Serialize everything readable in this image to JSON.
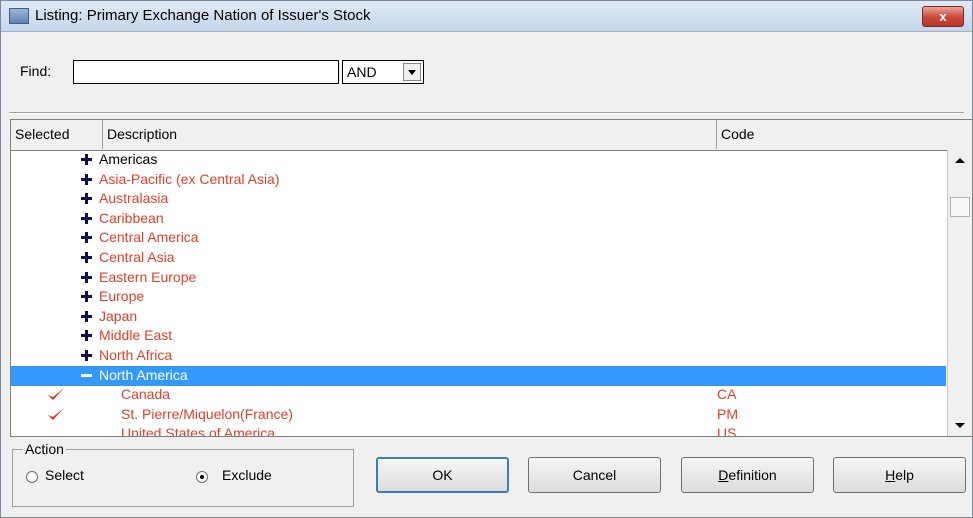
{
  "window": {
    "title": "Listing: Primary Exchange Nation of Issuer's Stock",
    "close_label": "x"
  },
  "find": {
    "label": "Find:",
    "value": "",
    "operator": "AND"
  },
  "grid": {
    "columns": [
      "Selected",
      "Description",
      "Code"
    ],
    "rows": [
      {
        "label": "Americas",
        "color": "black",
        "expand": "plus"
      },
      {
        "label": "Asia-Pacific (ex Central Asia)",
        "color": "red",
        "expand": "plus"
      },
      {
        "label": "Australasia",
        "color": "red",
        "expand": "plus"
      },
      {
        "label": "Caribbean",
        "color": "red",
        "expand": "plus"
      },
      {
        "label": "Central America",
        "color": "red",
        "expand": "plus"
      },
      {
        "label": "Central Asia",
        "color": "red",
        "expand": "plus"
      },
      {
        "label": "Eastern Europe",
        "color": "red",
        "expand": "plus"
      },
      {
        "label": "Europe",
        "color": "red",
        "expand": "plus"
      },
      {
        "label": "Japan",
        "color": "red",
        "expand": "plus"
      },
      {
        "label": "Middle East",
        "color": "red",
        "expand": "plus"
      },
      {
        "label": "North Africa",
        "color": "red",
        "expand": "plus"
      },
      {
        "label": "North America",
        "color": "white",
        "expand": "minus",
        "selected": true
      }
    ],
    "children": [
      {
        "label": "Canada",
        "code": "CA",
        "checked": true
      },
      {
        "label": "St. Pierre/Miquelon(France)",
        "code": "PM",
        "checked": true
      },
      {
        "label": "United States of America",
        "code": "US",
        "checked": false
      }
    ]
  },
  "action": {
    "legend": "Action",
    "options": [
      "Select",
      "Exclude"
    ],
    "selected": "Exclude"
  },
  "buttons": {
    "ok": "OK",
    "cancel": "Cancel",
    "definition_first": "D",
    "definition_rest": "efinition",
    "help_first": "H",
    "help_rest": "elp"
  },
  "colors": {
    "accent": "#3399ff",
    "region_text": "#e0402a",
    "check_mark": "#e03020"
  }
}
